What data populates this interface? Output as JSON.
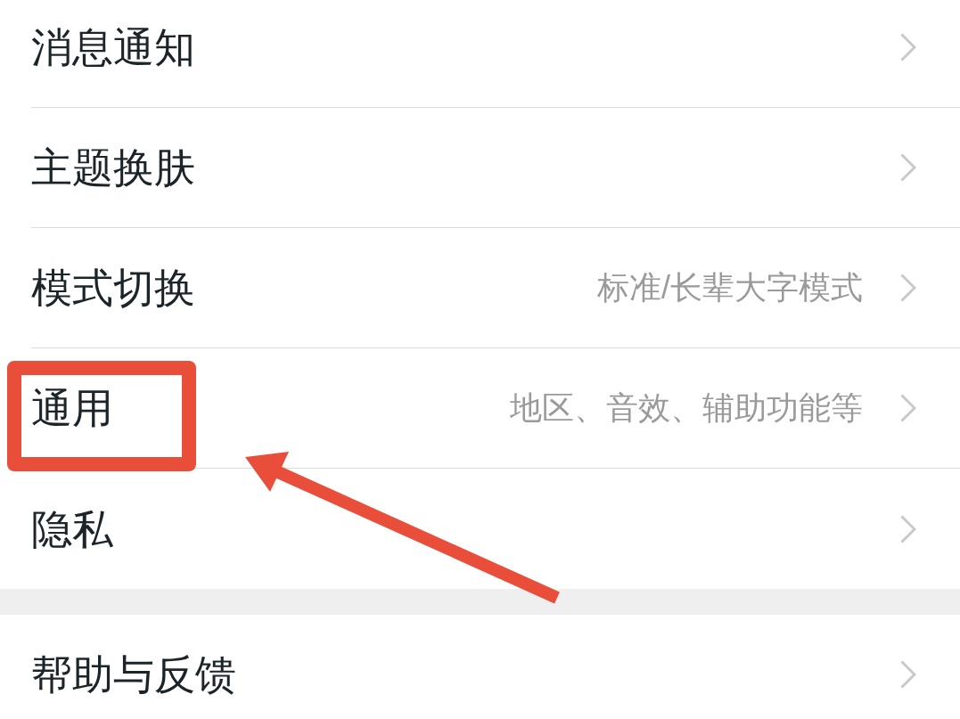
{
  "groups": [
    {
      "items": [
        {
          "title": "消息通知",
          "highlighted": false
        },
        {
          "title": "主题换肤",
          "highlighted": false
        },
        {
          "title": "模式切换",
          "value": "标准/长辈大字模式",
          "highlighted": false
        },
        {
          "title": "通用",
          "value": "地区、音效、辅助功能等",
          "highlighted": true
        },
        {
          "title": "隐私",
          "highlighted": false
        }
      ]
    },
    {
      "items": [
        {
          "title": "帮助与反馈",
          "highlighted": false
        }
      ]
    }
  ]
}
